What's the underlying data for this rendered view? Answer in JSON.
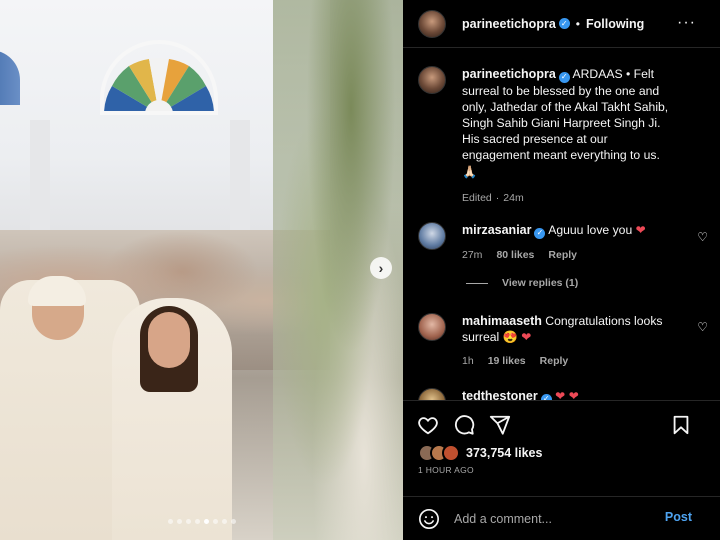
{
  "post": {
    "author": "parineetichopra",
    "verified": true,
    "follow_status": "Following",
    "more_icon": "more-horizontal-icon",
    "carousel": {
      "slide_count": 8,
      "active_index": 4,
      "next_icon": "chevron-right-icon"
    }
  },
  "caption": {
    "username": "parineetichopra",
    "text": "ARDAAS • Felt surreal to be blessed by the one and only, Jathedar of the Akal Takht Sahib, Singh Sahib Giani Harpreet Singh Ji. His sacred presence at our engagement meant everything to us. 🙏🏻",
    "edited": "Edited",
    "time": "24m"
  },
  "comments": [
    {
      "username": "mirzasaniar",
      "verified": true,
      "text": "Aguuu love you ❤️",
      "time": "27m",
      "likes": "80 likes",
      "reply": "Reply",
      "view_replies": "View replies (1)"
    },
    {
      "username": "mahimaaseth",
      "verified": false,
      "text": "Congratulations looks surreal 😍 ❤️",
      "time": "1h",
      "likes": "19 likes",
      "reply": "Reply"
    },
    {
      "username": "tedthestoner",
      "verified": true,
      "text": "❤️ ❤️"
    }
  ],
  "actions": {
    "like_icon": "heart-icon",
    "comment_icon": "comment-icon",
    "share_icon": "send-icon",
    "save_icon": "bookmark-icon",
    "likes_count": "373,754 likes",
    "time_ago": "1 HOUR AGO"
  },
  "comment_box": {
    "emoji_icon": "emoji-icon",
    "placeholder": "Add a comment...",
    "post_label": "Post"
  },
  "colors": {
    "background": "#000000",
    "text": "#f5f5f5",
    "secondary": "#a8a8a8",
    "link_blue": "#4ea3f0",
    "verified": "#3897f0",
    "heart_red": "#ed4956"
  }
}
